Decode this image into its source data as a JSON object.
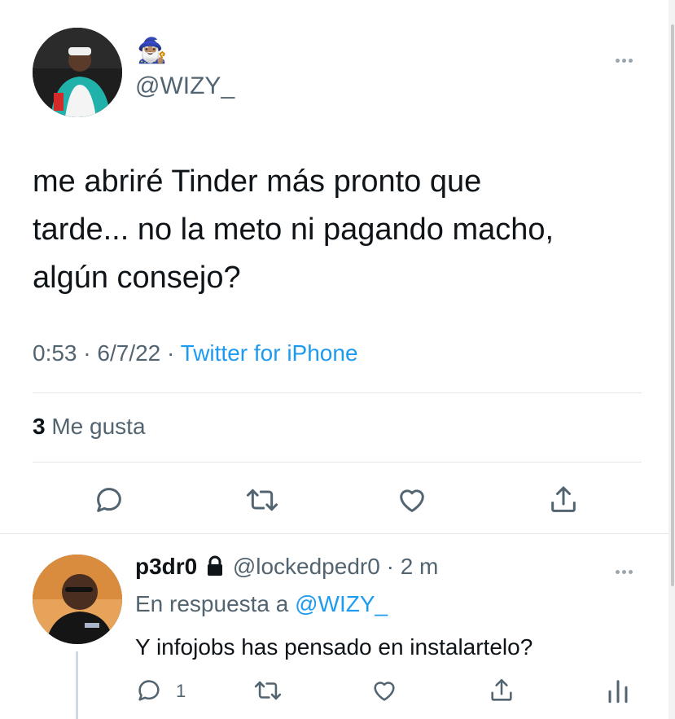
{
  "main_tweet": {
    "emoji": "🧙🏽‍♂️",
    "handle": "@WIZY_",
    "text_line1": "me abriré Tinder más pronto que",
    "text_line2": "tarde... no la meto ni pagando macho,",
    "text_line3": "algún consejo?",
    "time": "0:53",
    "date": "6/7/22",
    "sep": "·",
    "source": "Twitter for iPhone",
    "likes_count": "3",
    "likes_label": "Me gusta",
    "icons": [
      "reply-icon",
      "retweet-icon",
      "like-icon",
      "share-icon",
      "more-options-icon"
    ]
  },
  "reply": {
    "name": "p3dr0",
    "handle": "@lockedpedr0",
    "sep": "·",
    "age": "2 m",
    "replying_to_label": "En respuesta a",
    "replying_to_handle": "@WIZY_",
    "text": "Y infojobs has pensado en instalartelo?",
    "reply_count": "1",
    "icons": [
      "lock-icon",
      "reply-icon",
      "retweet-icon",
      "like-icon",
      "share-icon",
      "analytics-icon",
      "more-options-icon"
    ]
  },
  "colors": {
    "text": "#0f1419",
    "muted": "#536471",
    "link": "#1d9bf0",
    "divider": "#e1e6ea"
  }
}
